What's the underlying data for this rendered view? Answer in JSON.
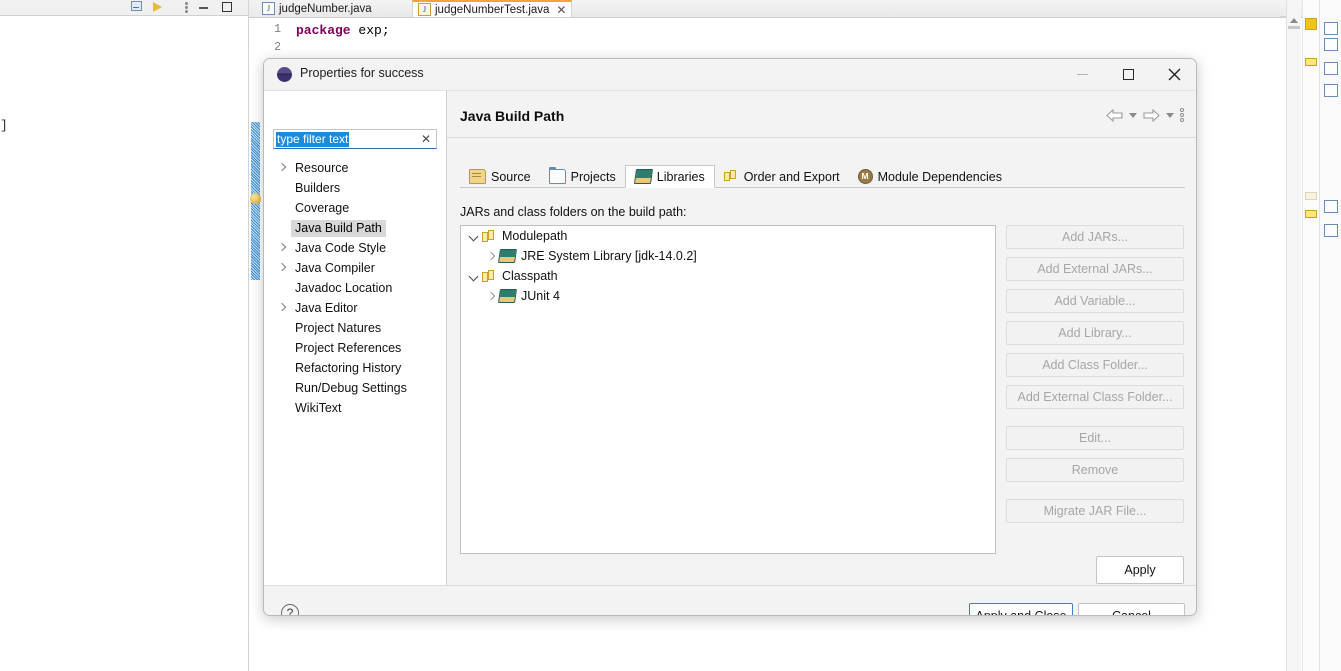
{
  "ide": {
    "editor_tabs": [
      {
        "label": "judgeNumber.java",
        "active": false,
        "closable": false
      },
      {
        "label": "judgeNumberTest.java",
        "active": true,
        "closable": true,
        "close_glyph": "✕"
      }
    ],
    "code_lines": [
      {
        "number": "1",
        "keyword": "package",
        "rest": " exp;"
      },
      {
        "number": "2",
        "keyword": "",
        "rest": ""
      }
    ],
    "left_bracket_text": "]",
    "toolbar_icons": [
      "collapse-all-icon",
      "link-with-editor-icon",
      "view-menu-icon",
      "minimize-icon",
      "maximize-icon"
    ]
  },
  "dialog": {
    "title": "Properties for success",
    "window_controls": {
      "minimize": "—",
      "maximize": "□",
      "close": "✕"
    },
    "filter": {
      "value": "type filter text",
      "placeholder": "type filter text",
      "clear_glyph": "✕"
    },
    "tree_items": [
      {
        "label": "Resource",
        "expandable": true,
        "selected": false
      },
      {
        "label": "Builders",
        "expandable": false,
        "selected": false
      },
      {
        "label": "Coverage",
        "expandable": false,
        "selected": false
      },
      {
        "label": "Java Build Path",
        "expandable": false,
        "selected": true
      },
      {
        "label": "Java Code Style",
        "expandable": true,
        "selected": false
      },
      {
        "label": "Java Compiler",
        "expandable": true,
        "selected": false
      },
      {
        "label": "Javadoc Location",
        "expandable": false,
        "selected": false
      },
      {
        "label": "Java Editor",
        "expandable": true,
        "selected": false
      },
      {
        "label": "Project Natures",
        "expandable": false,
        "selected": false
      },
      {
        "label": "Project References",
        "expandable": false,
        "selected": false
      },
      {
        "label": "Refactoring History",
        "expandable": false,
        "selected": false
      },
      {
        "label": "Run/Debug Settings",
        "expandable": false,
        "selected": false
      },
      {
        "label": "WikiText",
        "expandable": false,
        "selected": false
      }
    ],
    "page_title": "Java Build Path",
    "nav": {
      "back": "back-arrow-icon",
      "back_menu": "back-dropdown-icon",
      "forward": "forward-arrow-icon",
      "forward_menu": "forward-dropdown-icon",
      "more": "view-menu-icon"
    },
    "tabs": [
      {
        "label": "Source",
        "icon": "source-folder-icon",
        "active": false
      },
      {
        "label": "Projects",
        "icon": "projects-folder-icon",
        "active": false
      },
      {
        "label": "Libraries",
        "icon": "libraries-icon",
        "active": true
      },
      {
        "label": "Order and Export",
        "icon": "order-export-icon",
        "active": false
      },
      {
        "label": "Module Dependencies",
        "icon": "module-dependencies-icon",
        "icon_text": "M",
        "active": false
      }
    ],
    "section_label": "JARs and class folders on the build path:",
    "library_tree": [
      {
        "label": "Modulepath",
        "level": 0,
        "state": "expanded",
        "icon": "path-entry-icon"
      },
      {
        "label": "JRE System Library [jdk-14.0.2]",
        "level": 1,
        "state": "collapsed",
        "icon": "jar-library-icon"
      },
      {
        "label": "Classpath",
        "level": 0,
        "state": "expanded",
        "icon": "path-entry-icon"
      },
      {
        "label": "JUnit 4",
        "level": 1,
        "state": "collapsed",
        "icon": "jar-library-icon"
      }
    ],
    "side_buttons": [
      {
        "label": "Add JARs...",
        "enabled": false,
        "group": 0
      },
      {
        "label": "Add External JARs...",
        "enabled": false,
        "group": 0
      },
      {
        "label": "Add Variable...",
        "enabled": false,
        "group": 0
      },
      {
        "label": "Add Library...",
        "enabled": false,
        "group": 0
      },
      {
        "label": "Add Class Folder...",
        "enabled": false,
        "group": 0
      },
      {
        "label": "Add External Class Folder...",
        "enabled": false,
        "group": 0
      },
      {
        "label": "Edit...",
        "enabled": false,
        "group": 1
      },
      {
        "label": "Remove",
        "enabled": false,
        "group": 1
      },
      {
        "label": "Migrate JAR File...",
        "enabled": false,
        "group": 2
      }
    ],
    "apply_label": "Apply",
    "help_glyph": "?",
    "footer_buttons": [
      {
        "label": "Apply and Close",
        "primary": true
      },
      {
        "label": "Cancel",
        "primary": false
      }
    ]
  },
  "colors": {
    "accent": "#3b82c4",
    "selection": "#1a8ce0",
    "keyword": "#7f0055",
    "tree_selected_bg": "#d8d8d8",
    "dialog_bg": "#f3f3f3",
    "marker_yellow": "#f0c419"
  }
}
